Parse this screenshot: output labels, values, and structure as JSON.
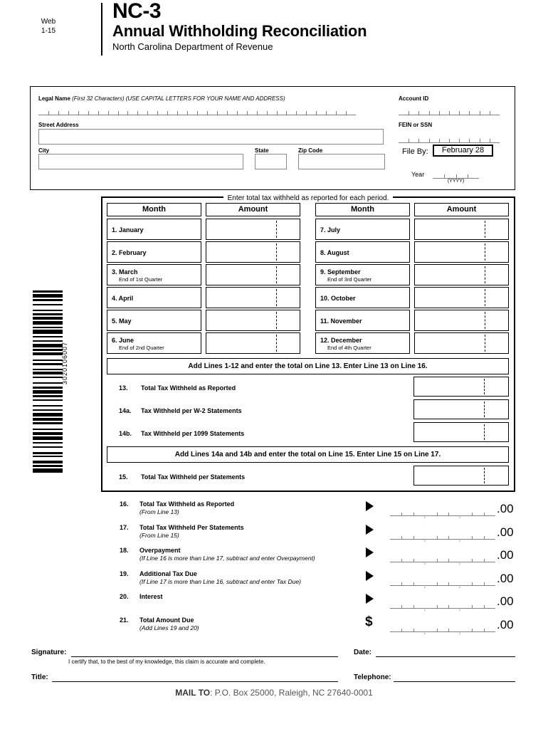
{
  "header": {
    "web": "Web",
    "revision": "1-15",
    "form_number": "NC-3",
    "title": "Annual Withholding Reconciliation",
    "department": "North Carolina Department of Revenue"
  },
  "address_block": {
    "legal_name_label": "Legal Name",
    "legal_name_note1": "(First 32 Characters)",
    "legal_name_note2": "(USE CAPITAL LETTERS FOR YOUR NAME AND ADDRESS)",
    "street_label": "Street Address",
    "city_label": "City",
    "state_label": "State",
    "zip_label": "Zip Code",
    "account_id_label": "Account ID",
    "fein_ssn_label": "FEIN or SSN",
    "file_by_label": "File By:",
    "file_by_value": "February 28",
    "year_label": "Year",
    "year_format": "(YYYY)",
    "legal_name_value": "",
    "street_value": "",
    "city_value": "",
    "state_value": "",
    "zip_value": ""
  },
  "barcode": {
    "number": "3020106007"
  },
  "period_table": {
    "banner": "Enter total tax withheld as reported for each period.",
    "col_month": "Month",
    "col_amount": "Amount",
    "left_rows": [
      {
        "label": "1. January",
        "sub": "",
        "amount": ""
      },
      {
        "label": "2. February",
        "sub": "",
        "amount": ""
      },
      {
        "label": "3. March",
        "sub": "End of 1st Quarter",
        "amount": ""
      },
      {
        "label": "4. April",
        "sub": "",
        "amount": ""
      },
      {
        "label": "5. May",
        "sub": "",
        "amount": ""
      },
      {
        "label": "6. June",
        "sub": "End of 2nd Quarter",
        "amount": ""
      }
    ],
    "right_rows": [
      {
        "label": "7. July",
        "sub": "",
        "amount": ""
      },
      {
        "label": "8. August",
        "sub": "",
        "amount": ""
      },
      {
        "label": "9. September",
        "sub": "End of 3rd Quarter",
        "amount": ""
      },
      {
        "label": "10. October",
        "sub": "",
        "amount": ""
      },
      {
        "label": "11. November",
        "sub": "",
        "amount": ""
      },
      {
        "label": "12. December",
        "sub": "End of 4th Quarter",
        "amount": ""
      }
    ]
  },
  "totals": {
    "band1": "Add Lines 1-12 and enter the total on Line 13.  Enter Line 13 on Line 16.",
    "band2": "Add Lines 14a and 14b and enter the total on Line 15.  Enter Line 15 on Line 17.",
    "rows": [
      {
        "no": "13.",
        "text": "Total Tax Withheld as Reported",
        "value": ""
      },
      {
        "no": "14a.",
        "text": "Tax Withheld per W-2 Statements",
        "value": ""
      },
      {
        "no": "14b.",
        "text": "Tax Withheld per 1099 Statements",
        "value": ""
      },
      {
        "no": "15.",
        "text": "Total Tax Withheld per Statements",
        "value": ""
      }
    ]
  },
  "bottom_lines": [
    {
      "no": "16.",
      "title": "Total Tax Withheld as Reported",
      "note": "(From Line 13)",
      "marker": "arrow",
      "value": "",
      "cents": ".00"
    },
    {
      "no": "17.",
      "title": "Total Tax Withheld Per Statements",
      "note": "(From Line 15)",
      "marker": "arrow",
      "value": "",
      "cents": ".00"
    },
    {
      "no": "18.",
      "title": "Overpayment",
      "note": "(If Line 16 is more than Line 17, subtract and enter Overpayment)",
      "marker": "arrow",
      "value": "",
      "cents": ".00"
    },
    {
      "no": "19.",
      "title": "Additional Tax Due",
      "note": "(If Line 17 is more than Line 16, subtract and enter Tax Due)",
      "marker": "arrow",
      "value": "",
      "cents": ".00"
    },
    {
      "no": "20.",
      "title": "Interest",
      "note": "",
      "marker": "arrow",
      "value": "",
      "cents": ".00"
    },
    {
      "no": "21.",
      "title": "Total Amount Due",
      "note": "(Add Lines 19 and 20)",
      "marker": "dollar",
      "value": "",
      "cents": ".00"
    }
  ],
  "footer": {
    "signature_label": "Signature:",
    "date_label": "Date:",
    "certify": "I certify that, to the best of my knowledge, this claim is accurate and complete.",
    "title_label": "Title:",
    "telephone_label": "Telephone:",
    "mail_to_bold": "MAIL TO",
    "mail_to_rest": ": P.O. Box 25000, Raleigh, NC 27640-0001",
    "signature_value": "",
    "date_value": "",
    "title_value": "",
    "telephone_value": ""
  }
}
